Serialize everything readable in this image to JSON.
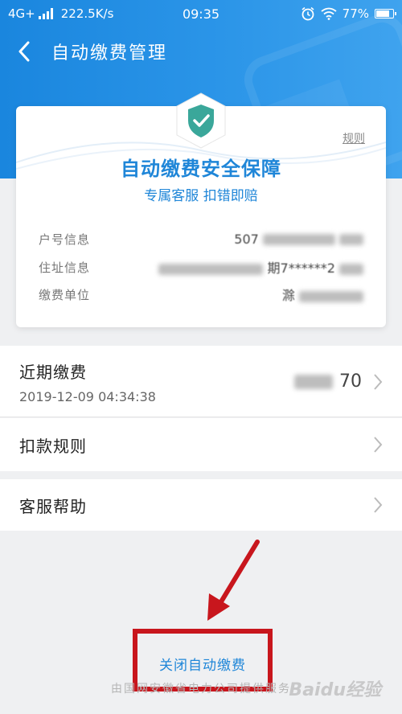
{
  "status_bar": {
    "network": "4G+",
    "speed": "222.5K/s",
    "time": "09:35",
    "battery": "77%"
  },
  "nav": {
    "title": "自动缴费管理"
  },
  "card": {
    "rule_link": "规则",
    "title": "自动缴费安全保障",
    "subtitle": "专属客服 扣错即赔",
    "rows": [
      {
        "label": "户号信息",
        "value": "507"
      },
      {
        "label": "住址信息",
        "value": "期7******2"
      },
      {
        "label": "缴费单位",
        "value": "滁"
      }
    ]
  },
  "recent": {
    "title": "近期缴费",
    "datetime": "2019-12-09 04:34:38",
    "amount": "70"
  },
  "menu": [
    {
      "label": "扣款规则"
    },
    {
      "label": "客服帮助"
    }
  ],
  "close_button": "关闭自动缴费",
  "footer": "由国网安徽省电力公司提供服务",
  "watermark": "Baidu经验",
  "colors": {
    "primary": "#1f86d8",
    "header": "#1a86de",
    "highlight_box": "#c8161d",
    "shield": "#3aa79a"
  }
}
